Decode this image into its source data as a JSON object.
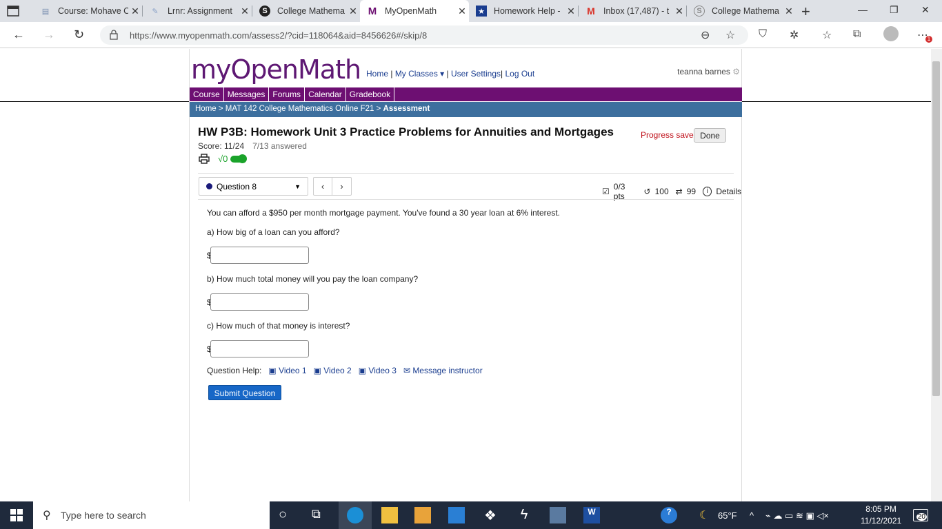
{
  "browser": {
    "tabs": [
      {
        "title": "Course: Mohave C"
      },
      {
        "title": "Lrnr: Assignment"
      },
      {
        "title": "College Mathema"
      },
      {
        "title": "MyOpenMath"
      },
      {
        "title": "Homework Help -"
      },
      {
        "title": "Inbox (17,487) - t"
      },
      {
        "title": "College Mathema"
      }
    ],
    "url": "https://www.myopenmath.com/assess2/?cid=118064&aid=8456626#/skip/8",
    "notification_badge": "1"
  },
  "site": {
    "logo_my": "my",
    "logo_openmath": "OpenMath",
    "links": {
      "home": "Home",
      "my_classes": "My Classes ▾",
      "user_settings": "User Settings",
      "log_out": "Log Out"
    },
    "user_name": "teanna barnes",
    "nav": [
      "Course",
      "Messages",
      "Forums",
      "Calendar",
      "Gradebook"
    ],
    "breadcrumb_prefix": "Home > MAT 142 College Mathematics Online F21 > ",
    "breadcrumb_current": "Assessment"
  },
  "assessment": {
    "title": "HW P3B: Homework Unit 3 Practice Problems for Annuities and Mortgages",
    "score": "Score: 11/24",
    "answered": "7/13 answered",
    "progress_saved": "Progress saved",
    "done_label": "Done",
    "sqrt_label": "√0"
  },
  "question": {
    "selector_label": "Question 8",
    "points": "0/3 pts",
    "attempts": "100",
    "regens": "99",
    "details": "Details",
    "prompt": "You can afford a $950 per month mortgage payment. You've found a 30 year loan at 6% interest.",
    "parts": [
      {
        "text": "a) How big of a loan can you afford?",
        "value": ""
      },
      {
        "text": "b) How much total money will you pay the loan company?",
        "value": ""
      },
      {
        "text": "c) How much of that money is interest?",
        "value": ""
      }
    ],
    "currency": "$",
    "help_label": "Question Help:",
    "videos": [
      "Video 1",
      "Video 2",
      "Video 3"
    ],
    "message_instructor": "Message instructor",
    "submit_label": "Submit Question"
  },
  "taskbar": {
    "search_placeholder": "Type here to search",
    "weather": "65°F",
    "time": "8:05 PM",
    "date": "11/12/2021",
    "notifications": "20"
  }
}
